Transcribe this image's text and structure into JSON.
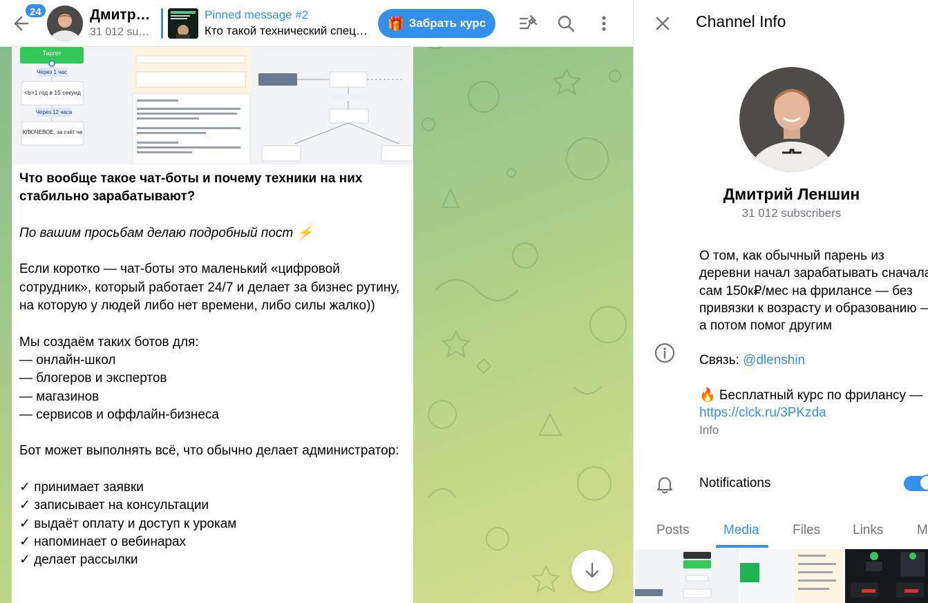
{
  "chat": {
    "unread_count": "24",
    "channel_name": "Дмитр…",
    "channel_subscribers": "31 012 su…",
    "pinned_title": "Pinned message #2",
    "pinned_text": "Кто такой технический спец…",
    "course_button": "Забрать курс",
    "message": {
      "heading": "Что вообще такое чат-боты и почему техники на них стабильно зарабатывают?",
      "intro": "По вашим просьбам делаю подробный пост ⚡",
      "para1": "Если коротко — чат-боты это маленький «цифровой сотрудник», который работает 24/7 и делает за бизнес рутину, на которую у людей либо нет времени, либо силы жалко))",
      "list1_title": "Мы создаём таких ботов для:",
      "list1": [
        "— онлайн-школ",
        "— блогеров и экспертов",
        "— магазинов",
        "— сервисов и оффлайн-бизнеса"
      ],
      "para2": "Бот может выполнять всё, что обычно делает администратор:",
      "list2": [
        "✓ принимает заявки",
        "✓ записывает на консультации",
        "✓ выдаёт оплату и доступ к урокам",
        "✓ напоминает о вебинарах",
        "✓ делает рассылки"
      ]
    },
    "preview_image": {
      "node_target": "Таргет",
      "wait1": "Через 1 час",
      "node_year": "<b>1 год в 15 секунд",
      "wait2": "Через 12 часа",
      "node_key": "КЛЮЧЕВОЕ, за счёт че"
    }
  },
  "info": {
    "title": "Channel Info",
    "name": "Дмитрий Леншин",
    "subscribers": "31 012 subscribers",
    "about": "О том, как обычный парень из деревни начал зарабатывать сначала сам 150к₽/мес на фрилансе — без привязки к возрасту и образованию — а потом помог другим",
    "contact_prefix": "Связь: ",
    "contact_handle": "@dlenshin",
    "course_line": "🔥 Бесплатный курс по фрилансу —",
    "course_link": "https://clck.ru/3PKzda",
    "about_label": "Info",
    "notifications_label": "Notifications",
    "notifications_on": true,
    "tabs": [
      "Posts",
      "Media",
      "Files",
      "Links",
      "M"
    ],
    "active_tab": "Media"
  },
  "colors": {
    "accent": "#3390ec",
    "muted": "#707579"
  },
  "icons": [
    "back-arrow-icon",
    "pinned-list-icon",
    "search-icon",
    "more-vertical-icon",
    "close-icon",
    "info-icon",
    "bell-icon",
    "arrow-down-icon",
    "gift-icon"
  ]
}
